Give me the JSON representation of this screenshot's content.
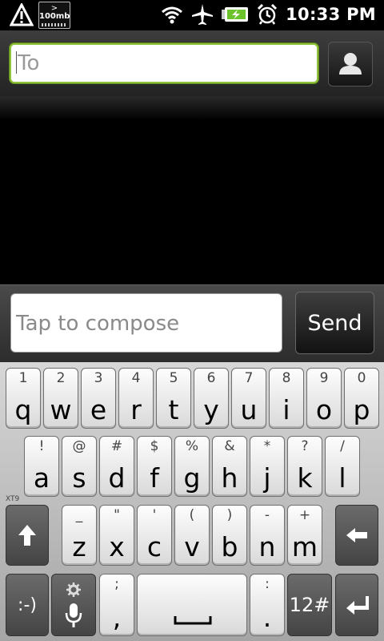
{
  "status_bar": {
    "memory_label_top": ">",
    "memory_label_bottom": "100mb",
    "time": "10:33 PM",
    "icons": [
      "warning-icon",
      "memory-card-icon",
      "wifi-icon",
      "airplane-icon",
      "battery-charging-icon",
      "alarm-icon"
    ]
  },
  "recipient": {
    "placeholder": "To"
  },
  "compose": {
    "placeholder": "Tap to compose",
    "send_label": "Send"
  },
  "keyboard": {
    "row1": [
      {
        "sub": "1",
        "main": "q"
      },
      {
        "sub": "2",
        "main": "w"
      },
      {
        "sub": "3",
        "main": "e"
      },
      {
        "sub": "4",
        "main": "r"
      },
      {
        "sub": "5",
        "main": "t"
      },
      {
        "sub": "6",
        "main": "y"
      },
      {
        "sub": "7",
        "main": "u"
      },
      {
        "sub": "8",
        "main": "i"
      },
      {
        "sub": "9",
        "main": "o"
      },
      {
        "sub": "0",
        "main": "p"
      }
    ],
    "row2": [
      {
        "sub": "!",
        "main": "a"
      },
      {
        "sub": "@",
        "main": "s"
      },
      {
        "sub": "#",
        "main": "d"
      },
      {
        "sub": "$",
        "main": "f"
      },
      {
        "sub": "%",
        "main": "g"
      },
      {
        "sub": "&",
        "main": "h"
      },
      {
        "sub": "*",
        "main": "j"
      },
      {
        "sub": "?",
        "main": "k"
      },
      {
        "sub": "/",
        "main": "l"
      }
    ],
    "row3": [
      {
        "sub": "_",
        "main": "z"
      },
      {
        "sub": "\"",
        "main": "x"
      },
      {
        "sub": "'",
        "main": "c"
      },
      {
        "sub": "(",
        "main": "v"
      },
      {
        "sub": ")",
        "main": "b"
      },
      {
        "sub": "-",
        "main": "n"
      },
      {
        "sub": "+",
        "main": "m"
      }
    ],
    "xt9_label": "XT9",
    "emoticon_label": ":-)",
    "semicolon_sub": ";",
    "comma_main": ",",
    "colon_sub": ":",
    "period_main": ".",
    "symbols_label": "12#",
    "accent_color": "#8fc23a"
  }
}
